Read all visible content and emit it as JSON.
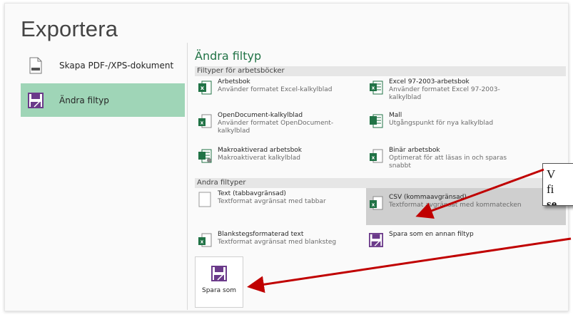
{
  "page_title": "Exportera",
  "left_menu": [
    {
      "label": "Skapa PDF-/XPS-dokument",
      "icon": "pdf-document-icon",
      "selected": false
    },
    {
      "label": "Ändra filtyp",
      "icon": "change-filetype-icon",
      "selected": true
    }
  ],
  "section_title": "Ändra filtyp",
  "workbook_types": {
    "header": "Filtyper för arbetsböcker",
    "items": [
      {
        "name": "Arbetsbok",
        "desc": "Använder formatet Excel-kalkylblad",
        "icon": "excel-workbook-icon"
      },
      {
        "name": "Excel 97-2003-arbetsbok",
        "desc": "Använder formatet Excel 97-2003-kalkylblad",
        "icon": "excel-97-icon"
      },
      {
        "name": "OpenDocument-kalkylblad",
        "desc": "Använder formatet OpenDocument-kalkylblad",
        "icon": "opendocument-icon"
      },
      {
        "name": "Mall",
        "desc": "Utgångspunkt för nya kalkylblad",
        "icon": "template-icon"
      },
      {
        "name": "Makroaktiverad arbetsbok",
        "desc": "Makroaktiverat kalkylblad",
        "icon": "macro-workbook-icon"
      },
      {
        "name": "Binär arbetsbok",
        "desc": "Optimerat för att läsas in och sparas snabbt",
        "icon": "binary-workbook-icon"
      }
    ]
  },
  "other_types": {
    "header": "Andra filtyper",
    "items": [
      {
        "name": "Text (tabbavgränsad)",
        "desc": "Textformat avgränsat med tabbar",
        "icon": "text-file-icon"
      },
      {
        "name": "CSV (kommaavgränsad)",
        "desc": "Textformat avgränsat med kommatecken",
        "icon": "csv-file-icon",
        "highlighted": true
      },
      {
        "name": "Blankstegsformaterad text",
        "desc": "Textformat avgränsat med blanksteg",
        "icon": "space-text-icon"
      },
      {
        "name": "Spara som en annan filtyp",
        "desc": "",
        "icon": "save-other-icon"
      }
    ]
  },
  "save_as_button": "Spara som",
  "callout": {
    "line1": "V",
    "line2": "fi",
    "line3": "se"
  },
  "colors": {
    "accent": "#217346",
    "selected_bg": "#9fd5b7",
    "arrow": "#c00000"
  }
}
